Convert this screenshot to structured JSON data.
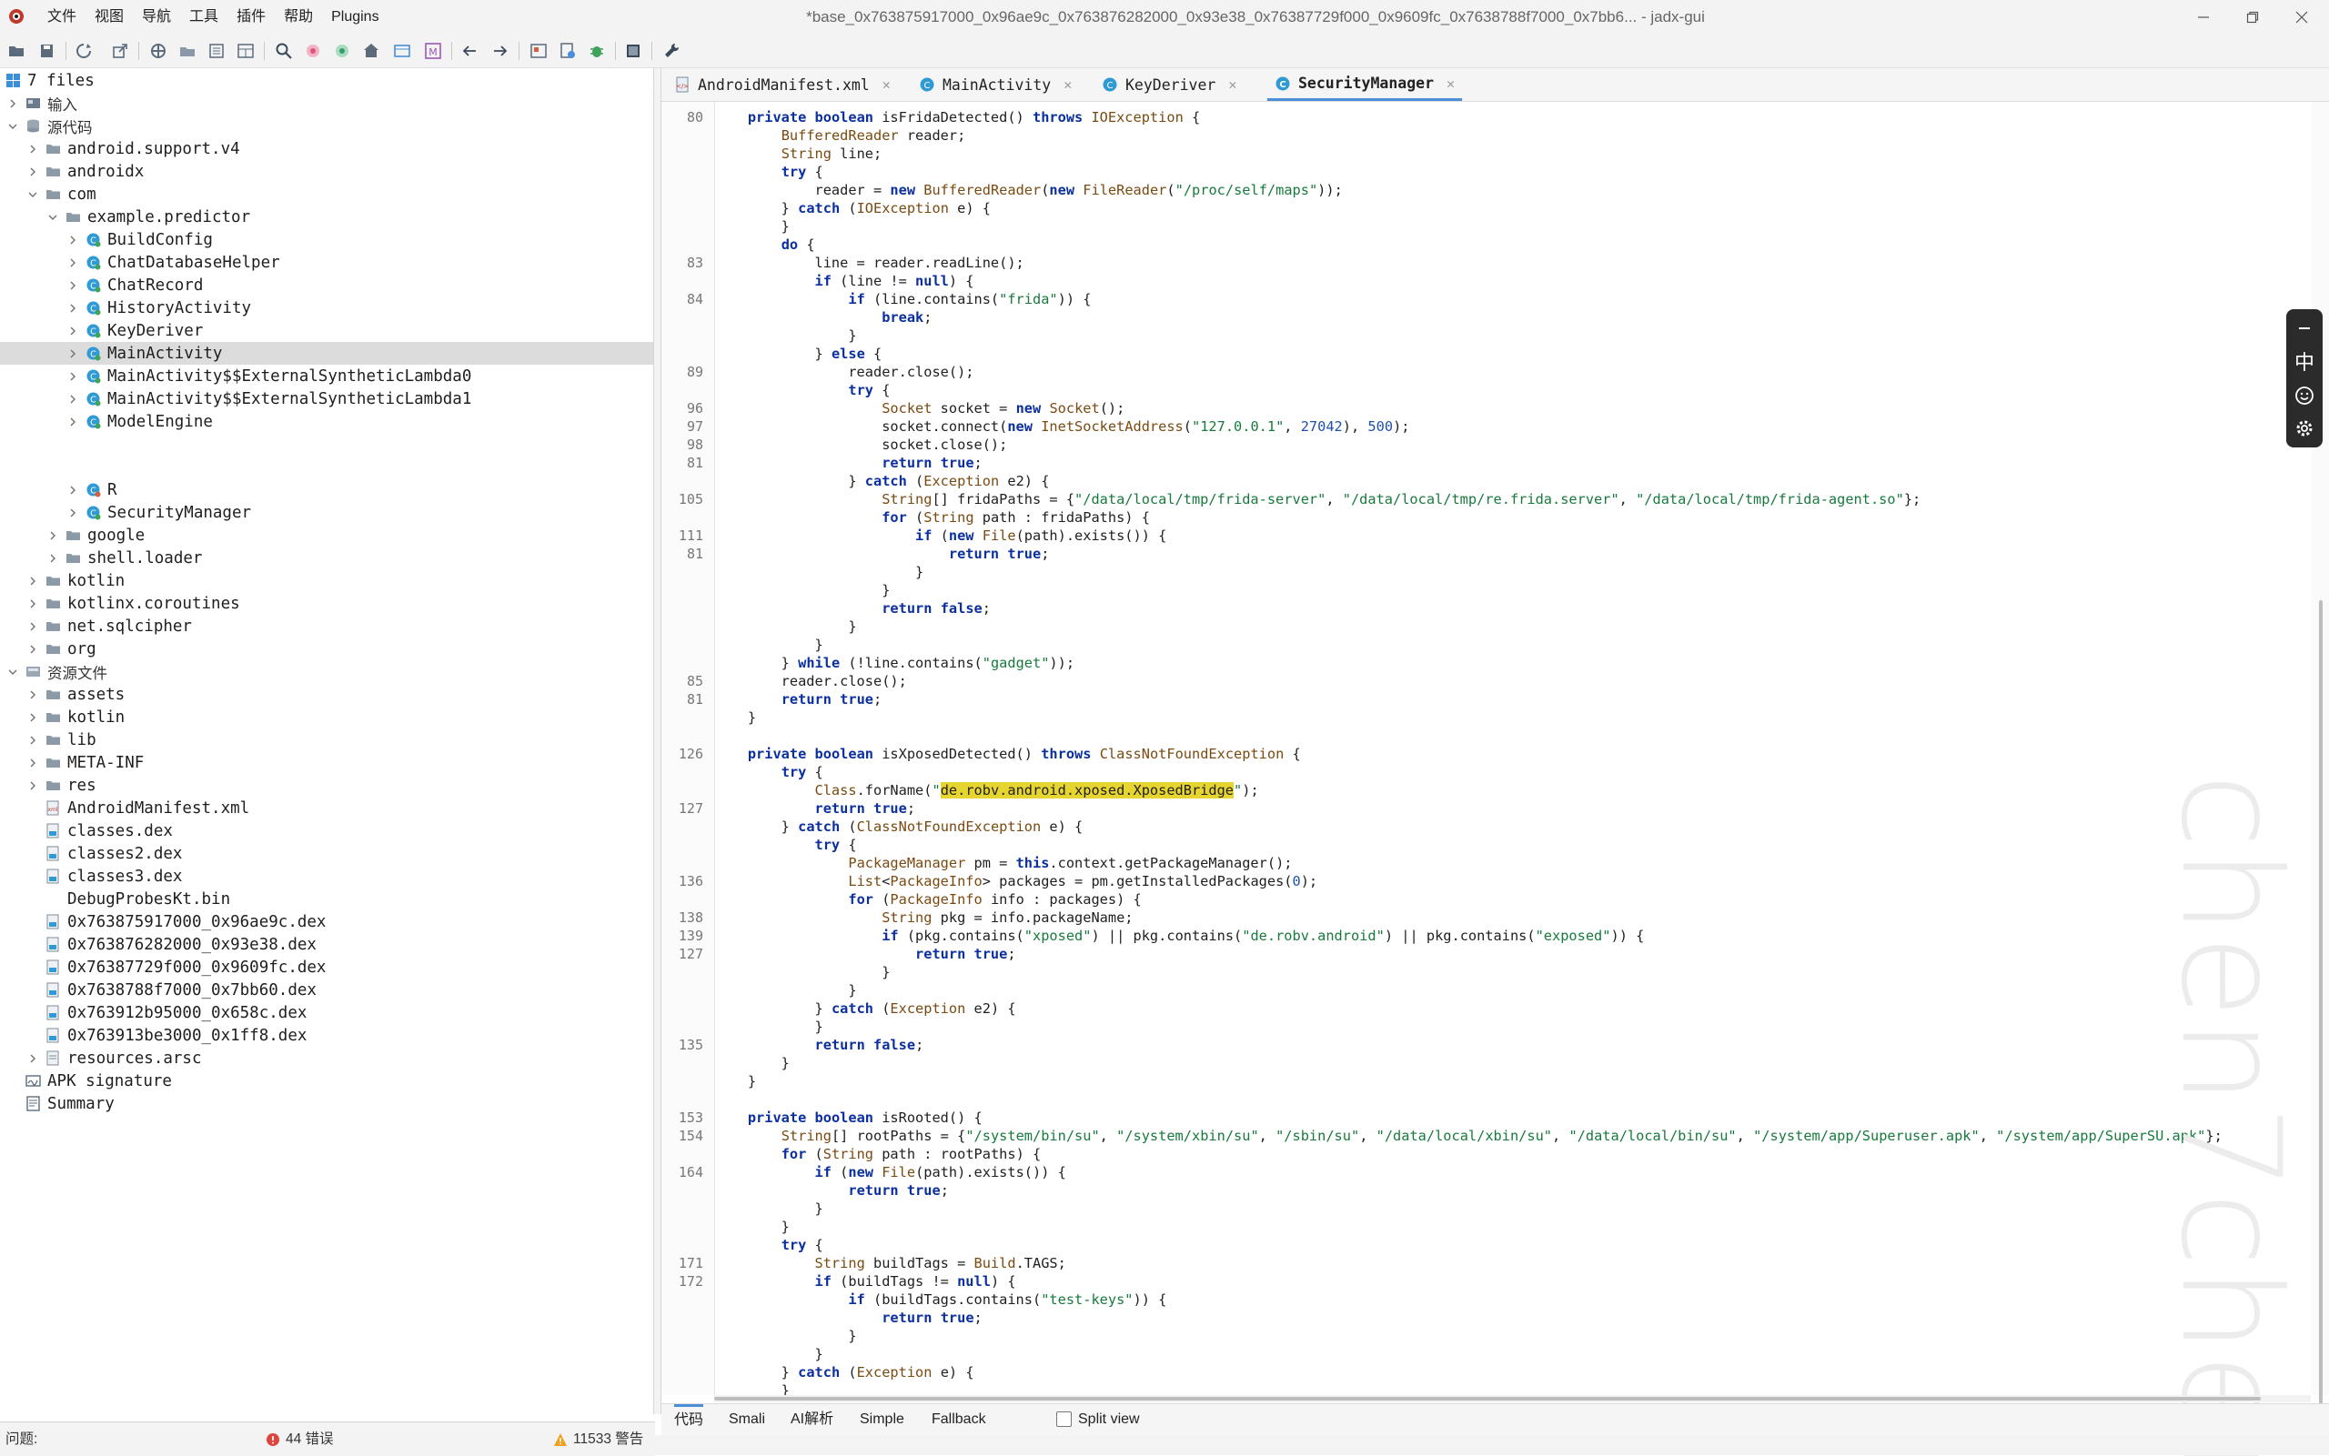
{
  "window": {
    "title": "*base_0x763875917000_0x96ae9c_0x763876282000_0x93e38_0x76387729f000_0x9609fc_0x7638788f7000_0x7bb6... - jadx-gui"
  },
  "menu": [
    "文件",
    "视图",
    "导航",
    "工具",
    "插件",
    "帮助",
    "Plugins"
  ],
  "toolbar": {
    "icons": [
      "open-file-icon",
      "save-all-icon",
      "sync-icon",
      "export-icon",
      "preferences-icon",
      "flatten-packages-icon",
      "show-inconsistent-icon",
      "quark-icon",
      "search-icon",
      "find-usage-icon",
      "search-text-icon",
      "home-icon",
      "deobfuscation-icon",
      "mapping-icon",
      "back-icon",
      "forward-icon",
      "decompile-all-icon",
      "bookmark-icon",
      "debug-icon",
      "log-icon",
      "wrench-icon"
    ]
  },
  "tree": {
    "root_label": "7 files",
    "items": [
      {
        "label": "输入",
        "depth": 0,
        "arrow": "right",
        "icon": "input"
      },
      {
        "label": "源代码",
        "depth": 0,
        "arrow": "down",
        "icon": "source"
      },
      {
        "label": "android.support.v4",
        "depth": 1,
        "arrow": "right",
        "icon": "package"
      },
      {
        "label": "androidx",
        "depth": 1,
        "arrow": "right",
        "icon": "package"
      },
      {
        "label": "com",
        "depth": 1,
        "arrow": "down",
        "icon": "package"
      },
      {
        "label": "example.predictor",
        "depth": 2,
        "arrow": "down",
        "icon": "package"
      },
      {
        "label": "BuildConfig",
        "depth": 3,
        "arrow": "right",
        "icon": "class"
      },
      {
        "label": "ChatDatabaseHelper",
        "depth": 3,
        "arrow": "right",
        "icon": "class"
      },
      {
        "label": "ChatRecord",
        "depth": 3,
        "arrow": "right",
        "icon": "class"
      },
      {
        "label": "HistoryActivity",
        "depth": 3,
        "arrow": "right",
        "icon": "class"
      },
      {
        "label": "KeyDeriver",
        "depth": 3,
        "arrow": "right",
        "icon": "class"
      },
      {
        "label": "MainActivity",
        "depth": 3,
        "arrow": "right",
        "icon": "class",
        "selected": true
      },
      {
        "label": "MainActivity$$ExternalSyntheticLambda0",
        "depth": 3,
        "arrow": "right",
        "icon": "class"
      },
      {
        "label": "MainActivity$$ExternalSyntheticLambda1",
        "depth": 3,
        "arrow": "right",
        "icon": "class"
      },
      {
        "label": "ModelEngine",
        "depth": 3,
        "arrow": "right",
        "icon": "class"
      },
      {
        "label": "",
        "depth": 3,
        "arrow": "none",
        "icon": "none"
      },
      {
        "label": "",
        "depth": 3,
        "arrow": "none",
        "icon": "none"
      },
      {
        "label": "R",
        "depth": 3,
        "arrow": "right",
        "icon": "class-r"
      },
      {
        "label": "SecurityManager",
        "depth": 3,
        "arrow": "right",
        "icon": "class"
      },
      {
        "label": "google",
        "depth": 2,
        "arrow": "right",
        "icon": "package"
      },
      {
        "label": "shell.loader",
        "depth": 2,
        "arrow": "right",
        "icon": "package"
      },
      {
        "label": "kotlin",
        "depth": 1,
        "arrow": "right",
        "icon": "package"
      },
      {
        "label": "kotlinx.coroutines",
        "depth": 1,
        "arrow": "right",
        "icon": "package"
      },
      {
        "label": "net.sqlcipher",
        "depth": 1,
        "arrow": "right",
        "icon": "package"
      },
      {
        "label": "org",
        "depth": 1,
        "arrow": "right",
        "icon": "package"
      },
      {
        "label": "资源文件",
        "depth": 0,
        "arrow": "down",
        "icon": "resources"
      },
      {
        "label": "assets",
        "depth": 1,
        "arrow": "right",
        "icon": "folder"
      },
      {
        "label": "kotlin",
        "depth": 1,
        "arrow": "right",
        "icon": "folder"
      },
      {
        "label": "lib",
        "depth": 1,
        "arrow": "right",
        "icon": "folder"
      },
      {
        "label": "META-INF",
        "depth": 1,
        "arrow": "right",
        "icon": "folder"
      },
      {
        "label": "res",
        "depth": 1,
        "arrow": "right",
        "icon": "folder"
      },
      {
        "label": "AndroidManifest.xml",
        "depth": 1,
        "arrow": "none",
        "icon": "xml"
      },
      {
        "label": "classes.dex",
        "depth": 1,
        "arrow": "none",
        "icon": "dex"
      },
      {
        "label": "classes2.dex",
        "depth": 1,
        "arrow": "none",
        "icon": "dex"
      },
      {
        "label": "classes3.dex",
        "depth": 1,
        "arrow": "none",
        "icon": "dex"
      },
      {
        "label": "DebugProbesKt.bin",
        "depth": 1,
        "arrow": "none",
        "icon": "file"
      },
      {
        "label": "0x763875917000_0x96ae9c.dex",
        "depth": 1,
        "arrow": "none",
        "icon": "dex"
      },
      {
        "label": "0x763876282000_0x93e38.dex",
        "depth": 1,
        "arrow": "none",
        "icon": "dex"
      },
      {
        "label": "0x76387729f000_0x9609fc.dex",
        "depth": 1,
        "arrow": "none",
        "icon": "dex"
      },
      {
        "label": "0x7638788f7000_0x7bb60.dex",
        "depth": 1,
        "arrow": "none",
        "icon": "dex"
      },
      {
        "label": "0x763912b95000_0x658c.dex",
        "depth": 1,
        "arrow": "none",
        "icon": "dex"
      },
      {
        "label": "0x763913be3000_0x1ff8.dex",
        "depth": 1,
        "arrow": "none",
        "icon": "dex"
      },
      {
        "label": "resources.arsc",
        "depth": 1,
        "arrow": "right",
        "icon": "arsc"
      },
      {
        "label": "APK signature",
        "depth": 0,
        "arrow": "none",
        "icon": "signature"
      },
      {
        "label": "Summary",
        "depth": 0,
        "arrow": "none",
        "icon": "summary"
      }
    ]
  },
  "tabs": [
    {
      "label": "AndroidManifest.xml",
      "icon": "xml",
      "active": false
    },
    {
      "label": "MainActivity",
      "icon": "class",
      "active": false
    },
    {
      "label": "KeyDeriver",
      "icon": "class",
      "active": false
    },
    {
      "label": "SecurityManager",
      "icon": "class",
      "active": true
    }
  ],
  "code": {
    "lines": [
      {
        "n": "80",
        "t": "    <k>private</k> <k>boolean</k> isFridaDetected() <k>throws</k> <y>IOException</y> {"
      },
      {
        "n": "",
        "t": "        <y>BufferedReader</y> reader;"
      },
      {
        "n": "",
        "t": "        <y>String</y> line;"
      },
      {
        "n": "",
        "t": "        <k>try</k> {"
      },
      {
        "n": "",
        "t": "            reader = <k>new</k> <y>BufferedReader</y>(<k>new</k> <y>FileReader</y>(<s>\"/proc/self/maps\"</s>));"
      },
      {
        "n": "",
        "t": "        } <k>catch</k> (<y>IOException</y> e) {"
      },
      {
        "n": "",
        "t": "        }"
      },
      {
        "n": "",
        "t": "        <k>do</k> {"
      },
      {
        "n": "83",
        "t": "            line = reader.readLine();"
      },
      {
        "n": "",
        "t": "            <k>if</k> (line != <k>null</k>) {"
      },
      {
        "n": "84",
        "t": "                <k>if</k> (line.contains(<s>\"frida\"</s>)) {"
      },
      {
        "n": "",
        "t": "                    <k>break</k>;"
      },
      {
        "n": "",
        "t": "                }"
      },
      {
        "n": "",
        "t": "            } <k>else</k> {"
      },
      {
        "n": "89",
        "t": "                reader.close();"
      },
      {
        "n": "",
        "t": "                <k>try</k> {"
      },
      {
        "n": "96",
        "t": "                    <y>Socket</y> socket = <k>new</k> <y>Socket</y>();"
      },
      {
        "n": "97",
        "t": "                    socket.connect(<k>new</k> <y>InetSocketAddress</y>(<s>\"127.0.0.1\"</s>, <n>27042</n>), <n>500</n>);"
      },
      {
        "n": "98",
        "t": "                    socket.close();"
      },
      {
        "n": "81",
        "t": "                    <k>return</k> <k>true</k>;"
      },
      {
        "n": "",
        "t": "                } <k>catch</k> (<y>Exception</y> e2) {"
      },
      {
        "n": "105",
        "t": "                    <y>String</y>[] fridaPaths = {<s>\"/data/local/tmp/frida-server\"</s>, <s>\"/data/local/tmp/re.frida.server\"</s>, <s>\"/data/local/tmp/frida-agent.so\"</s>};"
      },
      {
        "n": "",
        "t": "                    <k>for</k> (<y>String</y> path : fridaPaths) {"
      },
      {
        "n": "111",
        "t": "                        <k>if</k> (<k>new</k> <y>File</y>(path).exists()) {"
      },
      {
        "n": "81",
        "t": "                            <k>return</k> <k>true</k>;"
      },
      {
        "n": "",
        "t": "                        }"
      },
      {
        "n": "",
        "t": "                    }"
      },
      {
        "n": "",
        "t": "                    <k>return</k> <k>false</k>;"
      },
      {
        "n": "",
        "t": "                }"
      },
      {
        "n": "",
        "t": "            }"
      },
      {
        "n": "",
        "t": "        } <k>while</k> (!line.contains(<s>\"gadget\"</s>));"
      },
      {
        "n": "85",
        "t": "        reader.close();"
      },
      {
        "n": "81",
        "t": "        <k>return</k> <k>true</k>;"
      },
      {
        "n": "",
        "t": "    }"
      },
      {
        "n": "",
        "t": ""
      },
      {
        "n": "126",
        "t": "    <k>private</k> <k>boolean</k> isXposedDetected() <k>throws</k> <y>ClassNotFoundException</y> {"
      },
      {
        "n": "",
        "t": "        <k>try</k> {"
      },
      {
        "n": "",
        "t": "            <y>Class</y>.forName(<s>\"</s><h>de.robv.android.xposed.XposedBridge</h><s>\"</s>);"
      },
      {
        "n": "127",
        "t": "            <k>return</k> <k>true</k>;"
      },
      {
        "n": "",
        "t": "        } <k>catch</k> (<y>ClassNotFoundException</y> e) {"
      },
      {
        "n": "",
        "t": "            <k>try</k> {"
      },
      {
        "n": "",
        "t": "                <y>PackageManager</y> pm = <k>this</k>.context.getPackageManager();"
      },
      {
        "n": "136",
        "t": "                <y>List</y>&lt;<y>PackageInfo</y>&gt; packages = pm.getInstalledPackages(<n>0</n>);"
      },
      {
        "n": "",
        "t": "                <k>for</k> (<y>PackageInfo</y> info : packages) {"
      },
      {
        "n": "138",
        "t": "                    <y>String</y> pkg = info.packageName;"
      },
      {
        "n": "139",
        "t": "                    <k>if</k> (pkg.contains(<s>\"xposed\"</s>) || pkg.contains(<s>\"de.robv.android\"</s>) || pkg.contains(<s>\"exposed\"</s>)) {"
      },
      {
        "n": "127",
        "t": "                        <k>return</k> <k>true</k>;"
      },
      {
        "n": "",
        "t": "                    }"
      },
      {
        "n": "",
        "t": "                }"
      },
      {
        "n": "",
        "t": "            } <k>catch</k> (<y>Exception</y> e2) {"
      },
      {
        "n": "",
        "t": "            }"
      },
      {
        "n": "135",
        "t": "            <k>return</k> <k>false</k>;"
      },
      {
        "n": "",
        "t": "        }"
      },
      {
        "n": "",
        "t": "    }"
      },
      {
        "n": "",
        "t": ""
      },
      {
        "n": "153",
        "t": "    <k>private</k> <k>boolean</k> isRooted() {"
      },
      {
        "n": "154",
        "t": "        <y>String</y>[] rootPaths = {<s>\"/system/bin/su\"</s>, <s>\"/system/xbin/su\"</s>, <s>\"/sbin/su\"</s>, <s>\"/data/local/xbin/su\"</s>, <s>\"/data/local/bin/su\"</s>, <s>\"/system/app/Superuser.apk\"</s>, <s>\"/system/app/SuperSU.apk\"</s>};"
      },
      {
        "n": "",
        "t": "        <k>for</k> (<y>String</y> path : rootPaths) {"
      },
      {
        "n": "164",
        "t": "            <k>if</k> (<k>new</k> <y>File</y>(path).exists()) {"
      },
      {
        "n": "",
        "t": "                <k>return</k> <k>true</k>;"
      },
      {
        "n": "",
        "t": "            }"
      },
      {
        "n": "",
        "t": "        }"
      },
      {
        "n": "",
        "t": "        <k>try</k> {"
      },
      {
        "n": "171",
        "t": "            <y>String</y> buildTags = <y>Build</y>.TAGS;"
      },
      {
        "n": "172",
        "t": "            <k>if</k> (buildTags != <k>null</k>) {"
      },
      {
        "n": "",
        "t": "                <k>if</k> (buildTags.contains(<s>\"test-keys\"</s>)) {"
      },
      {
        "n": "",
        "t": "                    <k>return</k> <k>true</k>;"
      },
      {
        "n": "",
        "t": "                }"
      },
      {
        "n": "",
        "t": "            }"
      },
      {
        "n": "",
        "t": "        } <k>catch</k> (<y>Exception</y> e) {"
      },
      {
        "n": "",
        "t": "        }"
      }
    ]
  },
  "watermark": "chen7chen",
  "float_panel": [
    "minus-icon",
    "中",
    "emoji-icon",
    "settings-icon"
  ],
  "bottom_tabs": [
    {
      "label": "代码",
      "active": true
    },
    {
      "label": "Smali",
      "active": false
    },
    {
      "label": "AI解析",
      "active": false
    },
    {
      "label": "Simple",
      "active": false
    },
    {
      "label": "Fallback",
      "active": false
    }
  ],
  "split_view": {
    "label": "Split view",
    "checked": false
  },
  "status": {
    "problems_label": "问题:",
    "errors": "44 错误",
    "warnings": "11533 警告"
  },
  "colors": {
    "keyword": "#0b2f9e",
    "type": "#7a4a10",
    "string": "#177a3c",
    "number": "#1d4fb0",
    "highlight": "#e6d530",
    "accent": "#4a8fd8"
  }
}
